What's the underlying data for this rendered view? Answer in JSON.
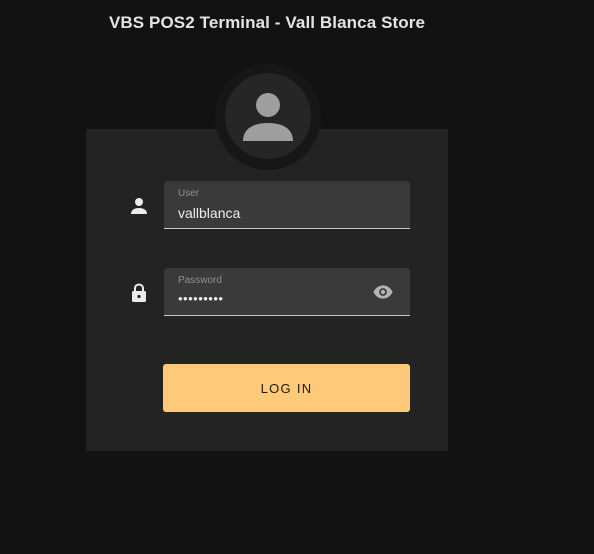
{
  "window": {
    "title": "VBS POS2 Terminal - Vall Blanca Store"
  },
  "login_form": {
    "avatar_icon": "account-circle-icon",
    "user": {
      "icon": "person-icon",
      "label": "User",
      "value": "vallblanca"
    },
    "password": {
      "icon": "lock-icon",
      "label": "Password",
      "masked_value": "•••••••••",
      "toggle_icon": "eye-icon"
    },
    "submit_label": "LOG IN"
  },
  "colors": {
    "background": "#121212",
    "card": "#232323",
    "field": "#3a3a3a",
    "accent": "#ffc97a"
  }
}
